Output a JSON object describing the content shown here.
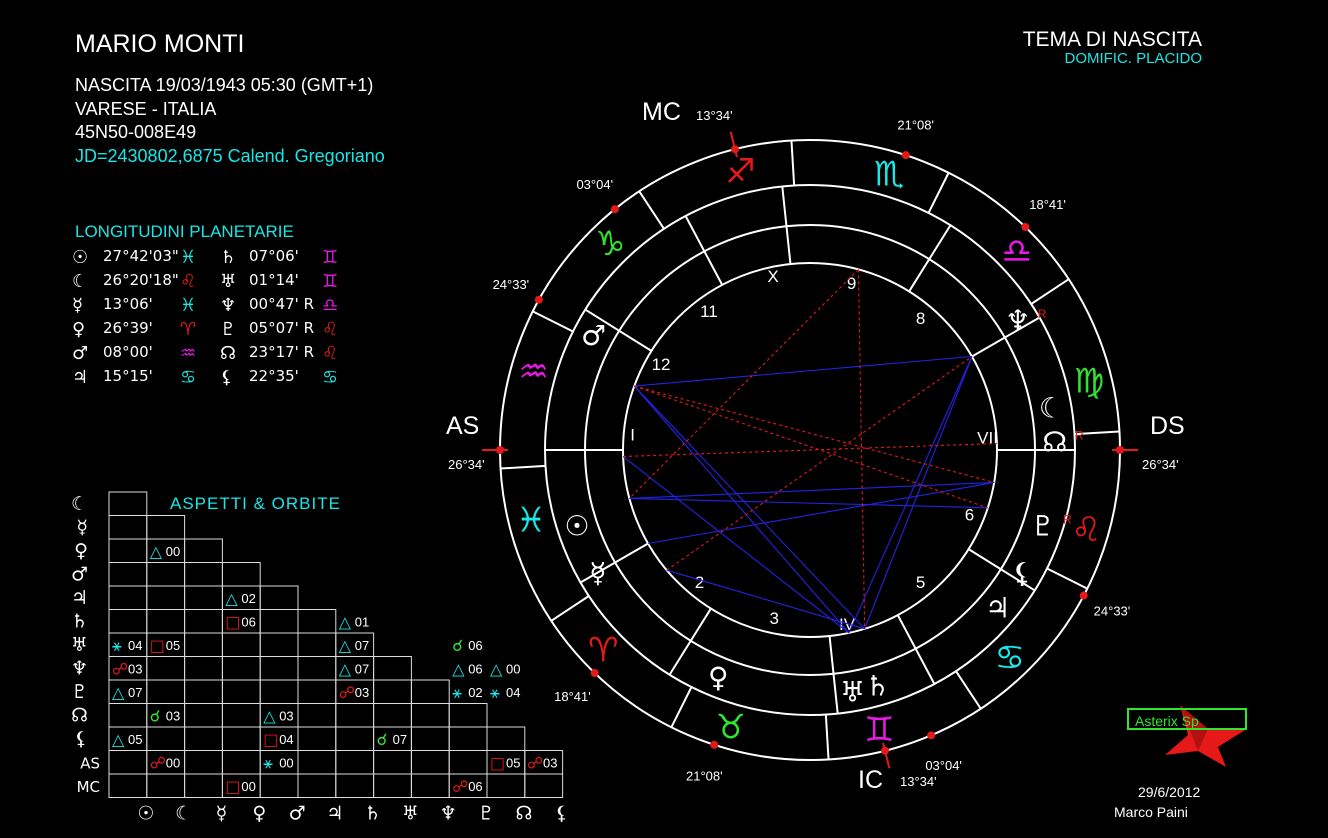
{
  "header": {
    "name": "MARIO MONTI",
    "birth": "NASCITA 19/03/1943 05:30 (GMT+1)",
    "place": "VARESE - ITALIA",
    "coords": "45N50-008E49",
    "julian": "JD=2430802,6875  Calend. Gregoriano"
  },
  "chart_title": "TEMA DI NASCITA",
  "chart_subtitle": "DOMIFIC. PLACIDO",
  "planet_section": {
    "title": "LONGITUDINI PLANETARIE",
    "rows": [
      {
        "left_glyph": "☉",
        "left_value": "27°42'03\"",
        "left_sign": "♓",
        "left_color": "#19e6e6",
        "right_glyph": "♄",
        "right_value": "07°06'",
        "right_sign": "♊",
        "right_color": "#e619e6"
      },
      {
        "left_glyph": "☾",
        "left_value": "26°20'18\"",
        "left_sign": "♌",
        "left_color": "#e61919",
        "right_glyph": "♅",
        "right_value": "01°14'",
        "right_sign": "♊",
        "right_color": "#e619e6"
      },
      {
        "left_glyph": "☿",
        "left_value": "13°06'",
        "left_sign": "♓",
        "left_color": "#19e6e6",
        "right_glyph": "♆",
        "right_value": "00°47' R",
        "right_sign": "♎",
        "right_color": "#e619e6"
      },
      {
        "left_glyph": "♀",
        "left_value": "26°39'",
        "left_sign": "♈",
        "left_color": "#e61919",
        "right_glyph": "♇",
        "right_value": "05°07' R",
        "right_sign": "♌",
        "right_color": "#e61919"
      },
      {
        "left_glyph": "♂",
        "left_value": "08°00'",
        "left_sign": "♒",
        "left_color": "#e619e6",
        "right_glyph": "☊",
        "right_value": "23°17' R",
        "right_sign": "♌",
        "right_color": "#e61919"
      },
      {
        "left_glyph": "♃",
        "left_value": "15°15'",
        "left_sign": "♋",
        "left_color": "#19e6e6",
        "right_glyph": "⚸",
        "right_value": "22°35'",
        "right_sign": "♋",
        "right_color": "#19e6e6"
      }
    ]
  },
  "aspects": {
    "title": "ASPETTI  &  ORBITE",
    "row_labels": [
      "☾",
      "☿",
      "♀",
      "♂",
      "♃",
      "♄",
      "♅",
      "♆",
      "♇",
      "☊",
      "⚸",
      "AS",
      "MC"
    ],
    "col_labels": [
      "☉",
      "☾",
      "☿",
      "♀",
      "♂",
      "♃",
      "♄",
      "♅",
      "♆",
      "♇",
      "☊",
      "⚸"
    ],
    "cells": [
      {
        "row": 2,
        "col": 1,
        "sym": "△",
        "orb": "00",
        "color": "#19e6e6"
      },
      {
        "row": 4,
        "col": 3,
        "sym": "△",
        "orb": "02",
        "color": "#19e6e6"
      },
      {
        "row": 5,
        "col": 3,
        "sym": "□",
        "orb": "06",
        "color": "#e61919"
      },
      {
        "row": 5,
        "col": 6,
        "sym": "△",
        "orb": "01",
        "color": "#19e6e6"
      },
      {
        "row": 6,
        "col": 0,
        "sym": "⚹",
        "orb": "04",
        "color": "#19e6e6"
      },
      {
        "row": 6,
        "col": 1,
        "sym": "□",
        "orb": "05",
        "color": "#e61919"
      },
      {
        "row": 6,
        "col": 6,
        "sym": "△",
        "orb": "07",
        "color": "#19e6e6"
      },
      {
        "row": 6,
        "col": 9,
        "sym": "☌",
        "orb": "06",
        "color": "#2ee62e"
      },
      {
        "row": 7,
        "col": 0,
        "sym": "☍",
        "orb": "03",
        "color": "#e61919"
      },
      {
        "row": 7,
        "col": 6,
        "sym": "△",
        "orb": "07",
        "color": "#19e6e6"
      },
      {
        "row": 7,
        "col": 9,
        "sym": "△",
        "orb": "06",
        "color": "#19e6e6"
      },
      {
        "row": 7,
        "col": 10,
        "sym": "△",
        "orb": "00",
        "color": "#19e6e6"
      },
      {
        "row": 8,
        "col": 0,
        "sym": "△",
        "orb": "07",
        "color": "#19e6e6"
      },
      {
        "row": 8,
        "col": 6,
        "sym": "☍",
        "orb": "03",
        "color": "#e61919"
      },
      {
        "row": 8,
        "col": 9,
        "sym": "⚹",
        "orb": "02",
        "color": "#19e6e6"
      },
      {
        "row": 8,
        "col": 10,
        "sym": "⚹",
        "orb": "04",
        "color": "#19e6e6"
      },
      {
        "row": 9,
        "col": 1,
        "sym": "☌",
        "orb": "03",
        "color": "#2ee62e"
      },
      {
        "row": 9,
        "col": 4,
        "sym": "△",
        "orb": "03",
        "color": "#19e6e6"
      },
      {
        "row": 10,
        "col": 0,
        "sym": "△",
        "orb": "05",
        "color": "#19e6e6"
      },
      {
        "row": 10,
        "col": 4,
        "sym": "□",
        "orb": "04",
        "color": "#e61919"
      },
      {
        "row": 10,
        "col": 7,
        "sym": "☌",
        "orb": "07",
        "color": "#2ee62e"
      },
      {
        "row": 11,
        "col": 1,
        "sym": "☍",
        "orb": "00",
        "color": "#e61919"
      },
      {
        "row": 11,
        "col": 4,
        "sym": "⚹",
        "orb": "00",
        "color": "#19e6e6"
      },
      {
        "row": 11,
        "col": 10,
        "sym": "□",
        "orb": "05",
        "color": "#e61919"
      },
      {
        "row": 11,
        "col": 14,
        "sym": "☍",
        "orb": "03",
        "color": "#e61919"
      },
      {
        "row": 12,
        "col": 3,
        "sym": "□",
        "orb": "00",
        "color": "#e61919"
      },
      {
        "row": 12,
        "col": 9,
        "sym": "☍",
        "orb": "06",
        "color": "#e61919"
      }
    ]
  },
  "wheel": {
    "angles": {
      "as": "AS",
      "ds": "DS",
      "mc": "MC",
      "ic": "IC"
    },
    "angle_degrees": {
      "as": "26°34'",
      "ds": "26°34'",
      "mc": "13°34'",
      "ic": "13°34'"
    },
    "cusp_degrees": [
      "21°08'",
      "18°41'",
      "24°33'",
      "03°04'",
      "21°08'",
      "18°41'",
      "24°33'",
      "03°04'"
    ],
    "house_numbers": [
      "X",
      "9",
      "8",
      "VII",
      "6",
      "5",
      "IV",
      "3",
      "2",
      "I",
      "12",
      "11"
    ],
    "retro_mark": "R",
    "signs": [
      {
        "glyph": "♐",
        "color": "#e61919"
      },
      {
        "glyph": "♏",
        "color": "#19e6e6"
      },
      {
        "glyph": "♎",
        "color": "#e619e6"
      },
      {
        "glyph": "♍",
        "color": "#2ee62e"
      },
      {
        "glyph": "♌",
        "color": "#e61919"
      },
      {
        "glyph": "♋",
        "color": "#19e6e6"
      },
      {
        "glyph": "♊",
        "color": "#e619e6"
      },
      {
        "glyph": "♉",
        "color": "#2ee62e"
      },
      {
        "glyph": "♈",
        "color": "#e61919"
      },
      {
        "glyph": "♓",
        "color": "#19e6e6"
      },
      {
        "glyph": "♒",
        "color": "#e619e6"
      },
      {
        "glyph": "♑",
        "color": "#2ee62e"
      }
    ],
    "planets": [
      {
        "glyph": "♆",
        "retro": true
      },
      {
        "glyph": "☾",
        "retro": false
      },
      {
        "glyph": "☊",
        "retro": true
      },
      {
        "glyph": "♇",
        "retro": true
      },
      {
        "glyph": "⚸",
        "retro": false
      },
      {
        "glyph": "♃",
        "retro": false
      },
      {
        "glyph": "♅",
        "retro": false
      },
      {
        "glyph": "♄",
        "retro": false
      },
      {
        "glyph": "♀",
        "retro": false
      },
      {
        "glyph": "☉",
        "retro": false
      },
      {
        "glyph": "☿",
        "retro": false
      },
      {
        "glyph": "♂",
        "retro": false
      }
    ]
  },
  "software": "Asterix Sp",
  "footer": {
    "date": "29/6/2012",
    "author": "Marco Paini"
  }
}
